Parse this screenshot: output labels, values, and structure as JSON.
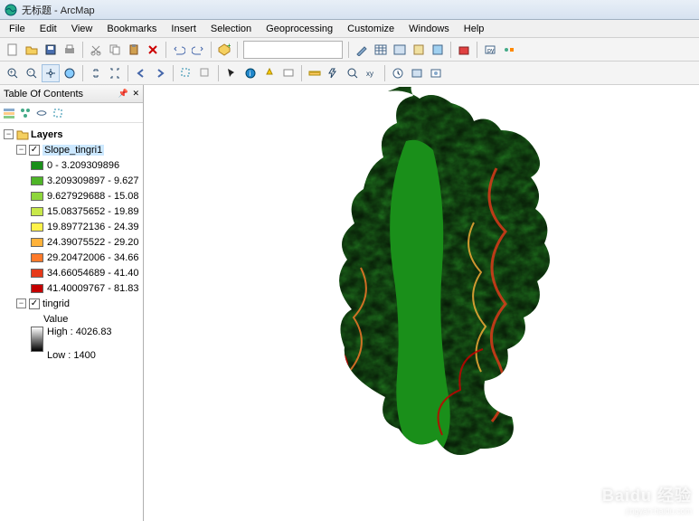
{
  "window": {
    "title": "无标题 - ArcMap"
  },
  "menus": [
    "File",
    "Edit",
    "View",
    "Bookmarks",
    "Insert",
    "Selection",
    "Geoprocessing",
    "Customize",
    "Windows",
    "Help"
  ],
  "toc": {
    "title": "Table Of Contents",
    "root": "Layers",
    "layer1": {
      "name": "Slope_tingri1",
      "classes": [
        {
          "color": "#1a8f1a",
          "label": "0 - 3.209309896"
        },
        {
          "color": "#4fb528",
          "label": "3.209309897 - 9.627"
        },
        {
          "color": "#8ed63c",
          "label": "9.627929688 - 15.08"
        },
        {
          "color": "#c8e84a",
          "label": "15.08375652 - 19.89"
        },
        {
          "color": "#fff24a",
          "label": "19.89772136 - 24.39"
        },
        {
          "color": "#ffb23a",
          "label": "24.39075522 - 29.20"
        },
        {
          "color": "#ff7a2a",
          "label": "29.20472006 - 34.66"
        },
        {
          "color": "#e63a1a",
          "label": "34.66054689 - 41.40"
        },
        {
          "color": "#c40000",
          "label": "41.40009767 - 81.83"
        }
      ]
    },
    "layer2": {
      "name": "tingrid",
      "value_label": "Value",
      "high": "High : 4026.83",
      "low": "Low : 1400"
    }
  },
  "watermark": {
    "main": "Baidu 经验",
    "sub": "jingyan.baidu.com"
  }
}
